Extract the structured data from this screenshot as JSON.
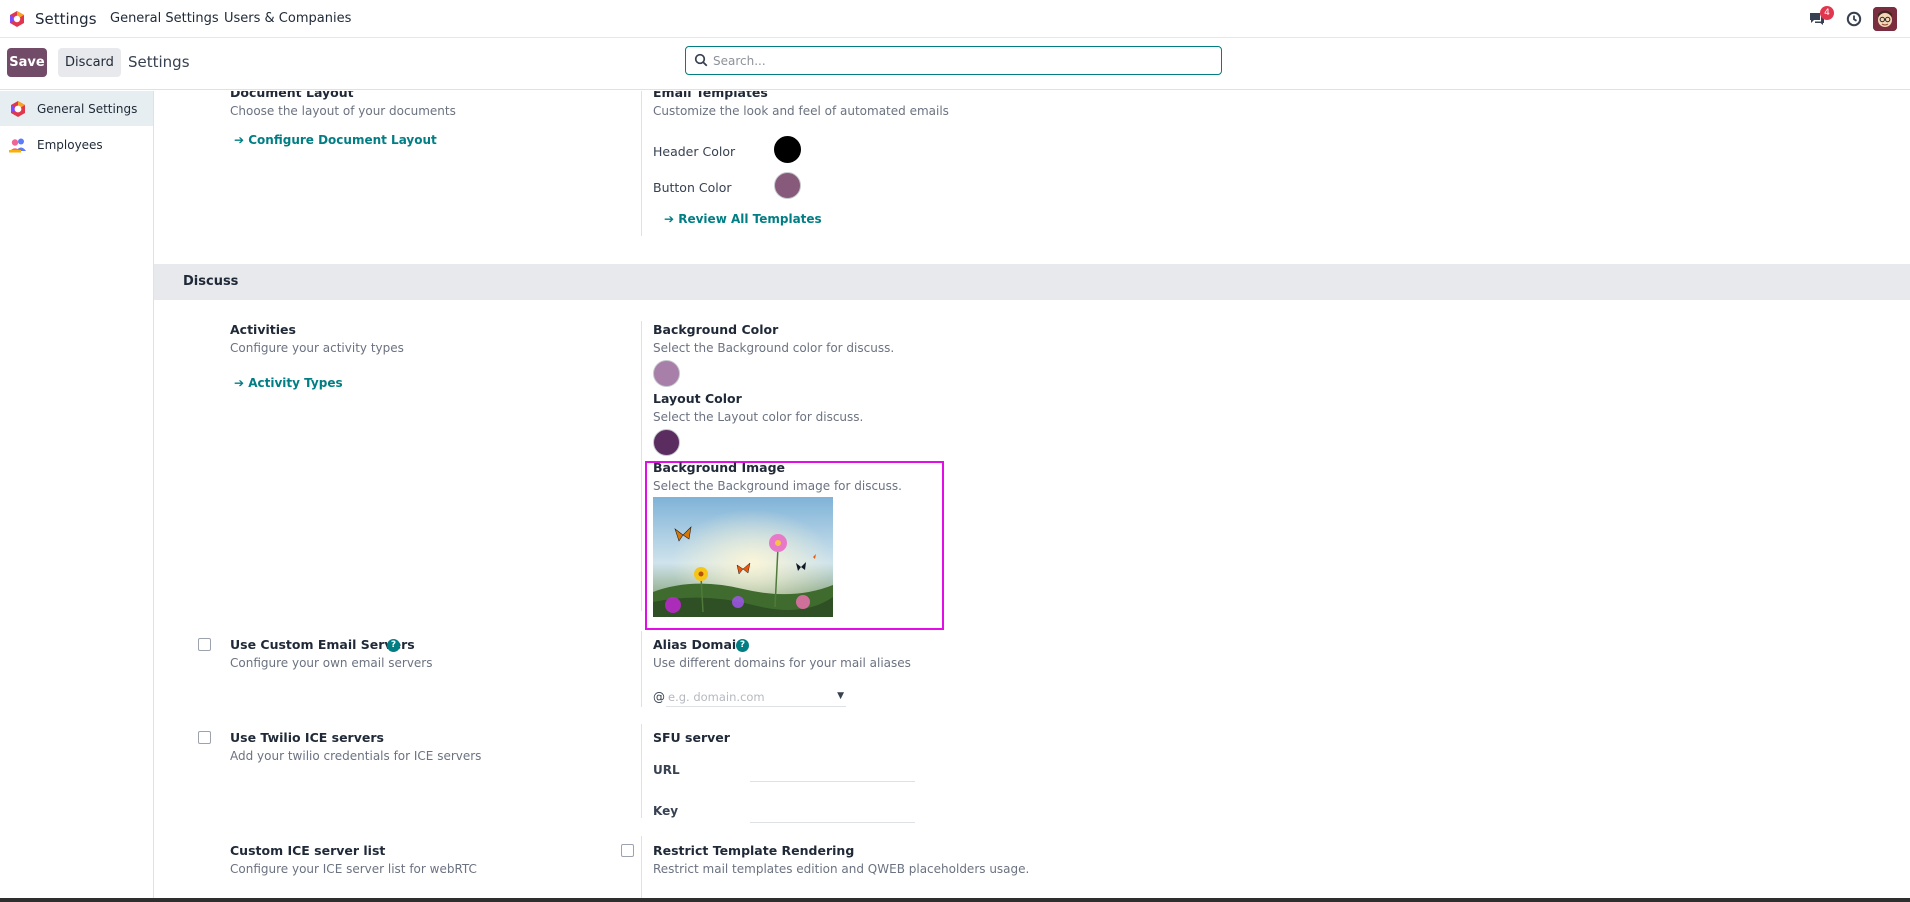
{
  "navbar": {
    "app_name": "Settings",
    "menu": [
      "General Settings",
      "Users & Companies"
    ],
    "chat_badge": "4",
    "icons": {
      "logo": "odoo-logo-icon",
      "chat": "chat-icon",
      "activity": "clock-icon",
      "avatar": "user-avatar"
    }
  },
  "control": {
    "save_label": "Save",
    "discard_label": "Discard",
    "title": "Settings",
    "search_placeholder": "Search..."
  },
  "sidebar": {
    "items": [
      {
        "label": "General Settings",
        "active": true
      },
      {
        "label": "Employees",
        "active": false
      }
    ]
  },
  "settings": {
    "document_layout": {
      "title": "Document Layout",
      "desc": "Choose the layout of your documents",
      "link": "Configure Document Layout"
    },
    "email_templates": {
      "title": "Email Templates",
      "desc": "Customize the look and feel of automated emails",
      "header_color_label": "Header Color",
      "button_color_label": "Button Color",
      "link": "Review All Templates"
    },
    "discuss": {
      "section_title": "Discuss",
      "activities": {
        "title": "Activities",
        "desc": "Configure your activity types",
        "link": "Activity Types"
      },
      "background_color": {
        "title": "Background Color",
        "desc": "Select the Background color for discuss."
      },
      "layout_color": {
        "title": "Layout Color",
        "desc": "Select the Layout color for discuss."
      },
      "background_image": {
        "title": "Background Image",
        "desc": "Select the Background image for discuss."
      },
      "custom_email_servers": {
        "title": "Use Custom Email Servers",
        "desc": "Configure your own email servers",
        "checked": false
      },
      "alias_domain": {
        "title": "Alias Domain",
        "desc": "Use different domains for your mail aliases",
        "prefix": "@",
        "placeholder": "e.g. domain.com"
      },
      "twilio": {
        "title": "Use Twilio ICE servers",
        "desc": "Add your twilio credentials for ICE servers",
        "checked": false
      },
      "sfu": {
        "title": "SFU server",
        "url_label": "URL",
        "key_label": "Key"
      },
      "custom_ice": {
        "title": "Custom ICE server list",
        "desc": "Configure your ICE server list for webRTC"
      },
      "restrict_template": {
        "title": "Restrict Template Rendering",
        "desc": "Restrict mail templates edition and QWEB placeholders usage.",
        "checked": false
      }
    }
  },
  "colors": {
    "brand": "#714b67",
    "accent": "#017e84",
    "header_color": "#000000",
    "button_color": "#875a7b",
    "discuss_background_color": "#a77fa8",
    "discuss_layout_color": "#5b2c5f",
    "highlight": "#e30ee7"
  }
}
